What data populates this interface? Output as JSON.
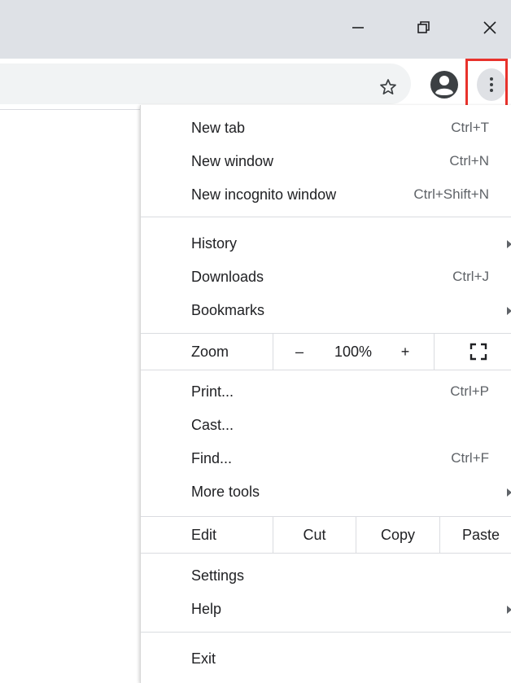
{
  "window": {
    "minimize_icon": "minimize-icon",
    "restore_icon": "restore-icon",
    "close_icon": "close-icon"
  },
  "toolbar": {
    "star_icon": "star-outline-icon",
    "avatar_icon": "account-circle-icon",
    "menu_icon": "three-dots-vertical-icon"
  },
  "menu": {
    "group1": [
      {
        "label": "New tab",
        "shortcut": "Ctrl+T"
      },
      {
        "label": "New window",
        "shortcut": "Ctrl+N"
      },
      {
        "label": "New incognito window",
        "shortcut": "Ctrl+Shift+N"
      }
    ],
    "group2": [
      {
        "label": "History",
        "shortcut": ""
      },
      {
        "label": "Downloads",
        "shortcut": "Ctrl+J"
      },
      {
        "label": "Bookmarks",
        "shortcut": ""
      }
    ],
    "zoom": {
      "label": "Zoom",
      "minus": "–",
      "value": "100%",
      "plus": "+",
      "fullscreen_icon": "fullscreen-icon"
    },
    "group3": [
      {
        "label": "Print...",
        "shortcut": "Ctrl+P"
      },
      {
        "label": "Cast...",
        "shortcut": ""
      },
      {
        "label": "Find...",
        "shortcut": "Ctrl+F"
      },
      {
        "label": "More tools",
        "shortcut": ""
      }
    ],
    "edit": {
      "label": "Edit",
      "cut": "Cut",
      "copy": "Copy",
      "paste": "Paste"
    },
    "group4": [
      {
        "label": "Settings",
        "shortcut": ""
      },
      {
        "label": "Help",
        "shortcut": ""
      }
    ],
    "exit": {
      "label": "Exit"
    }
  },
  "colors": {
    "titlebar": "#dee1e6",
    "omnibox": "#f1f3f4",
    "highlight": "#e8322c"
  }
}
